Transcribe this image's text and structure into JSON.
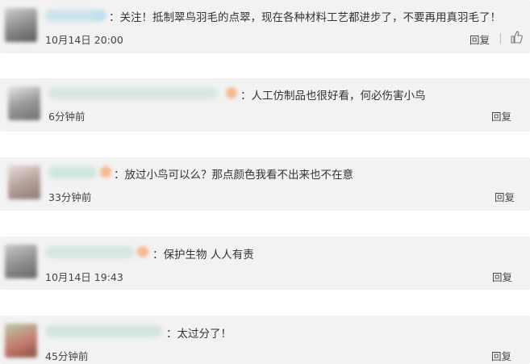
{
  "comments": [
    {
      "text": "：关注！抵制翠鸟羽毛的点翠，现在各种材料工艺都进步了，不要再用真羽毛了！",
      "time": "10月14日 20:00",
      "reply_label": "回复"
    },
    {
      "text": "：人工仿制品也很好看，何必伤害小鸟",
      "time": "6分钟前",
      "reply_label": "回复"
    },
    {
      "text": "：放过小鸟可以么？那点颜色我看不出来也不在意",
      "time": "33分钟前",
      "reply_label": "回复"
    },
    {
      "text": "：保护生物 人人有责",
      "time": "10月14日 19:43",
      "reply_label": "回复"
    },
    {
      "text": "：太过分了！",
      "time": "45分钟前",
      "reply_label": "回复"
    }
  ],
  "icons": {
    "like": "thumbs-up-icon"
  },
  "colors": {
    "card_background": "#f2f2f2",
    "text": "#333333",
    "badge": "#f7b98d"
  }
}
